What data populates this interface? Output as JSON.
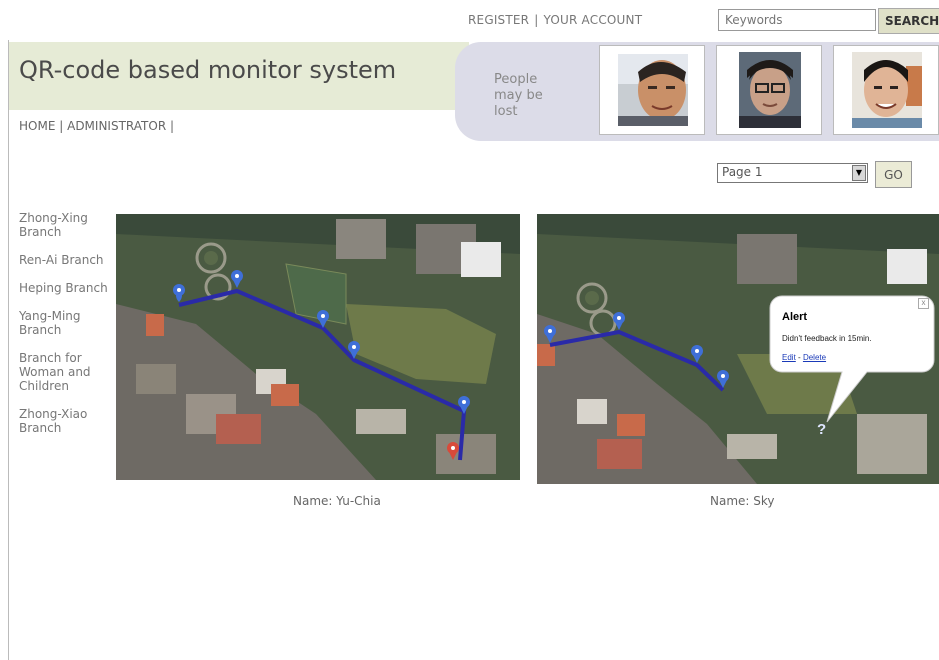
{
  "top_nav": {
    "register": "REGISTER",
    "separator": "|",
    "account": "YOUR ACCOUNT"
  },
  "search": {
    "placeholder": "Keywords",
    "button_label": "SEARCH"
  },
  "site": {
    "title": "QR-code based monitor system"
  },
  "main_nav": {
    "home": "HOME",
    "separator": "|",
    "administrator": "ADMINISTRATOR",
    "trailing": "|"
  },
  "lost_panel": {
    "label_line1": "People",
    "label_line2": "may be",
    "label_line3": "lost",
    "photo_count": 3
  },
  "pager": {
    "selected": "Page 1",
    "go_label": "GO"
  },
  "branches": [
    {
      "line1": "Zhong-Xing",
      "line2": "Branch"
    },
    {
      "line1": "Ren-Ai Branch"
    },
    {
      "line1": "Heping Branch"
    },
    {
      "line1": "Yang-Ming",
      "line2": "Branch"
    },
    {
      "line1": "Branch for",
      "line2": "Woman and",
      "line3": "Children"
    },
    {
      "line1": "Zhong-Xiao",
      "line2": "Branch"
    }
  ],
  "maps": [
    {
      "caption": "Name: Yu-Chia",
      "route_color": "#2a2aa8",
      "marker_color": "#3f6fd8",
      "end_marker_color": "#d84a3a"
    },
    {
      "caption": "Name: Sky",
      "alert": {
        "title": "Alert",
        "message": "Didn't feedback in 15min.",
        "edit": "Edit",
        "dash": "-",
        "delete": "Delete",
        "close": "x",
        "marker": "?"
      }
    }
  ],
  "colors": {
    "header_band": "#e6ebd6",
    "lost_panel": "#dcdce8",
    "button": "#dfe0c8"
  }
}
